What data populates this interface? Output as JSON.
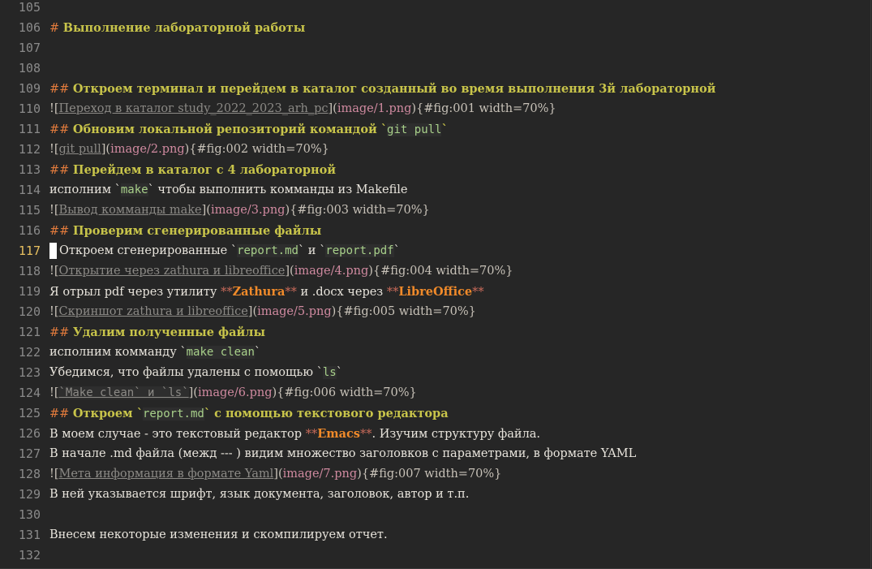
{
  "lines": [
    {
      "n": "105",
      "segs": []
    },
    {
      "n": "106",
      "segs": [
        {
          "t": "# ",
          "c": "h"
        },
        {
          "t": "Выполнение лабораторной работы",
          "c": "ht"
        }
      ]
    },
    {
      "n": "107",
      "segs": []
    },
    {
      "n": "108",
      "segs": []
    },
    {
      "n": "109",
      "segs": [
        {
          "t": "## ",
          "c": "h"
        },
        {
          "t": "Откроем терминал и перейдем в каталог созданный во время выполнения 3й лабораторной",
          "c": "ht"
        }
      ]
    },
    {
      "n": "110",
      "segs": [
        {
          "t": "![",
          "c": "p"
        },
        {
          "t": "Переход в каталог study_2022_2023_arh_pc",
          "c": "lt"
        },
        {
          "t": "](",
          "c": "p"
        },
        {
          "t": "image/1.png",
          "c": "url"
        },
        {
          "t": "){#fig:001 width=70%}",
          "c": "p"
        }
      ]
    },
    {
      "n": "111",
      "segs": [
        {
          "t": "## ",
          "c": "h"
        },
        {
          "t": "Обновим локальной репозиторий командой ",
          "c": "ht"
        },
        {
          "t": "`",
          "c": "ht"
        },
        {
          "t": "git pull",
          "c": "mono g"
        },
        {
          "t": "`",
          "c": "ht"
        }
      ]
    },
    {
      "n": "112",
      "segs": [
        {
          "t": "![",
          "c": "p"
        },
        {
          "t": "git pull",
          "c": "lt"
        },
        {
          "t": "](",
          "c": "p"
        },
        {
          "t": "image/2.png",
          "c": "url"
        },
        {
          "t": "){#fig:002 width=70%}",
          "c": "p"
        }
      ]
    },
    {
      "n": "113",
      "segs": [
        {
          "t": "## ",
          "c": "h"
        },
        {
          "t": "Перейдем в каталог с 4 лабораторной",
          "c": "ht"
        }
      ]
    },
    {
      "n": "114",
      "segs": [
        {
          "t": "исполним `",
          "c": ""
        },
        {
          "t": "make",
          "c": "mono g"
        },
        {
          "t": "` чтобы выполнить комманды из Makefile",
          "c": ""
        }
      ]
    },
    {
      "n": "115",
      "segs": [
        {
          "t": "![",
          "c": "p"
        },
        {
          "t": "Вывод комманды make",
          "c": "lt"
        },
        {
          "t": "](",
          "c": "p"
        },
        {
          "t": "image/3.png",
          "c": "url"
        },
        {
          "t": "){#fig:003 width=70%}",
          "c": "p"
        }
      ]
    },
    {
      "n": "116",
      "segs": [
        {
          "t": "## ",
          "c": "h"
        },
        {
          "t": "Проверим сгенерированные файлы",
          "c": "ht"
        }
      ]
    },
    {
      "n": "117",
      "current": true,
      "segs": [
        {
          "t": "Откроем сгенерированные `",
          "c": ""
        },
        {
          "t": "report.md",
          "c": "mono g"
        },
        {
          "t": "` и `",
          "c": ""
        },
        {
          "t": "report.pdf",
          "c": "mono g"
        },
        {
          "t": "`",
          "c": ""
        }
      ]
    },
    {
      "n": "118",
      "segs": [
        {
          "t": "![",
          "c": "p"
        },
        {
          "t": "Открытие через zathura и libreoffice",
          "c": "lt"
        },
        {
          "t": "](",
          "c": "p"
        },
        {
          "t": "image/4.png",
          "c": "url"
        },
        {
          "t": "){#fig:004 width=70%}",
          "c": "p"
        }
      ]
    },
    {
      "n": "119",
      "segs": [
        {
          "t": "Я отрыл pdf через утилиту ",
          "c": ""
        },
        {
          "t": "**",
          "c": "star"
        },
        {
          "t": "Zathura",
          "c": "em"
        },
        {
          "t": "**",
          "c": "star"
        },
        {
          "t": " и .docx через ",
          "c": ""
        },
        {
          "t": "**",
          "c": "star"
        },
        {
          "t": "LibreOffice",
          "c": "em"
        },
        {
          "t": "**",
          "c": "star"
        }
      ]
    },
    {
      "n": "120",
      "segs": [
        {
          "t": "![",
          "c": "p"
        },
        {
          "t": "Скриншот zathura и libreoffice",
          "c": "lt"
        },
        {
          "t": "](",
          "c": "p"
        },
        {
          "t": "image/5.png",
          "c": "url"
        },
        {
          "t": "){#fig:005 width=70%}",
          "c": "p"
        }
      ]
    },
    {
      "n": "121",
      "segs": [
        {
          "t": "## ",
          "c": "h"
        },
        {
          "t": "Удалим полученные файлы",
          "c": "ht"
        }
      ]
    },
    {
      "n": "122",
      "segs": [
        {
          "t": "исполним комманду `",
          "c": ""
        },
        {
          "t": "make clean",
          "c": "mono g"
        },
        {
          "t": "`",
          "c": ""
        }
      ]
    },
    {
      "n": "123",
      "segs": [
        {
          "t": "Убедимся, что файлы удалены с помощью `",
          "c": ""
        },
        {
          "t": "ls",
          "c": "mono g"
        },
        {
          "t": "`",
          "c": ""
        }
      ]
    },
    {
      "n": "124",
      "segs": [
        {
          "t": "![",
          "c": "p"
        },
        {
          "t": "`Make clean` и `ls`",
          "c": "mono gl"
        },
        {
          "t": "](",
          "c": "p"
        },
        {
          "t": "image/6.png",
          "c": "url"
        },
        {
          "t": "){#fig:006 width=70%}",
          "c": "p"
        }
      ]
    },
    {
      "n": "125",
      "segs": [
        {
          "t": "## ",
          "c": "h"
        },
        {
          "t": "Откроем `",
          "c": "ht"
        },
        {
          "t": "report.md",
          "c": "mono g"
        },
        {
          "t": "` с помощью текстового редактора",
          "c": "ht"
        }
      ]
    },
    {
      "n": "126",
      "segs": [
        {
          "t": "В моем случае - это текстовый редактор ",
          "c": ""
        },
        {
          "t": "**",
          "c": "star"
        },
        {
          "t": "Emacs",
          "c": "em"
        },
        {
          "t": "**",
          "c": "star"
        },
        {
          "t": ". Изучим структуру файла.",
          "c": ""
        }
      ]
    },
    {
      "n": "127",
      "segs": [
        {
          "t": "В начале .md файла (межд --- ) видим множество заголовков с параметрами, в формате YAML",
          "c": ""
        }
      ]
    },
    {
      "n": "128",
      "segs": [
        {
          "t": "![",
          "c": "p"
        },
        {
          "t": "Мета информация в формате Yaml",
          "c": "lt"
        },
        {
          "t": "](",
          "c": "p"
        },
        {
          "t": "image/7.png",
          "c": "url"
        },
        {
          "t": "){#fig:007 width=70%}",
          "c": "p"
        }
      ]
    },
    {
      "n": "129",
      "segs": [
        {
          "t": "В ней указывается шрифт, язык документа, заголовок, автор и т.п.",
          "c": ""
        }
      ]
    },
    {
      "n": "130",
      "segs": []
    },
    {
      "n": "131",
      "segs": [
        {
          "t": "Внесем некоторые изменения и скомпилируем отчет.",
          "c": ""
        }
      ]
    },
    {
      "n": "132",
      "segs": []
    }
  ]
}
